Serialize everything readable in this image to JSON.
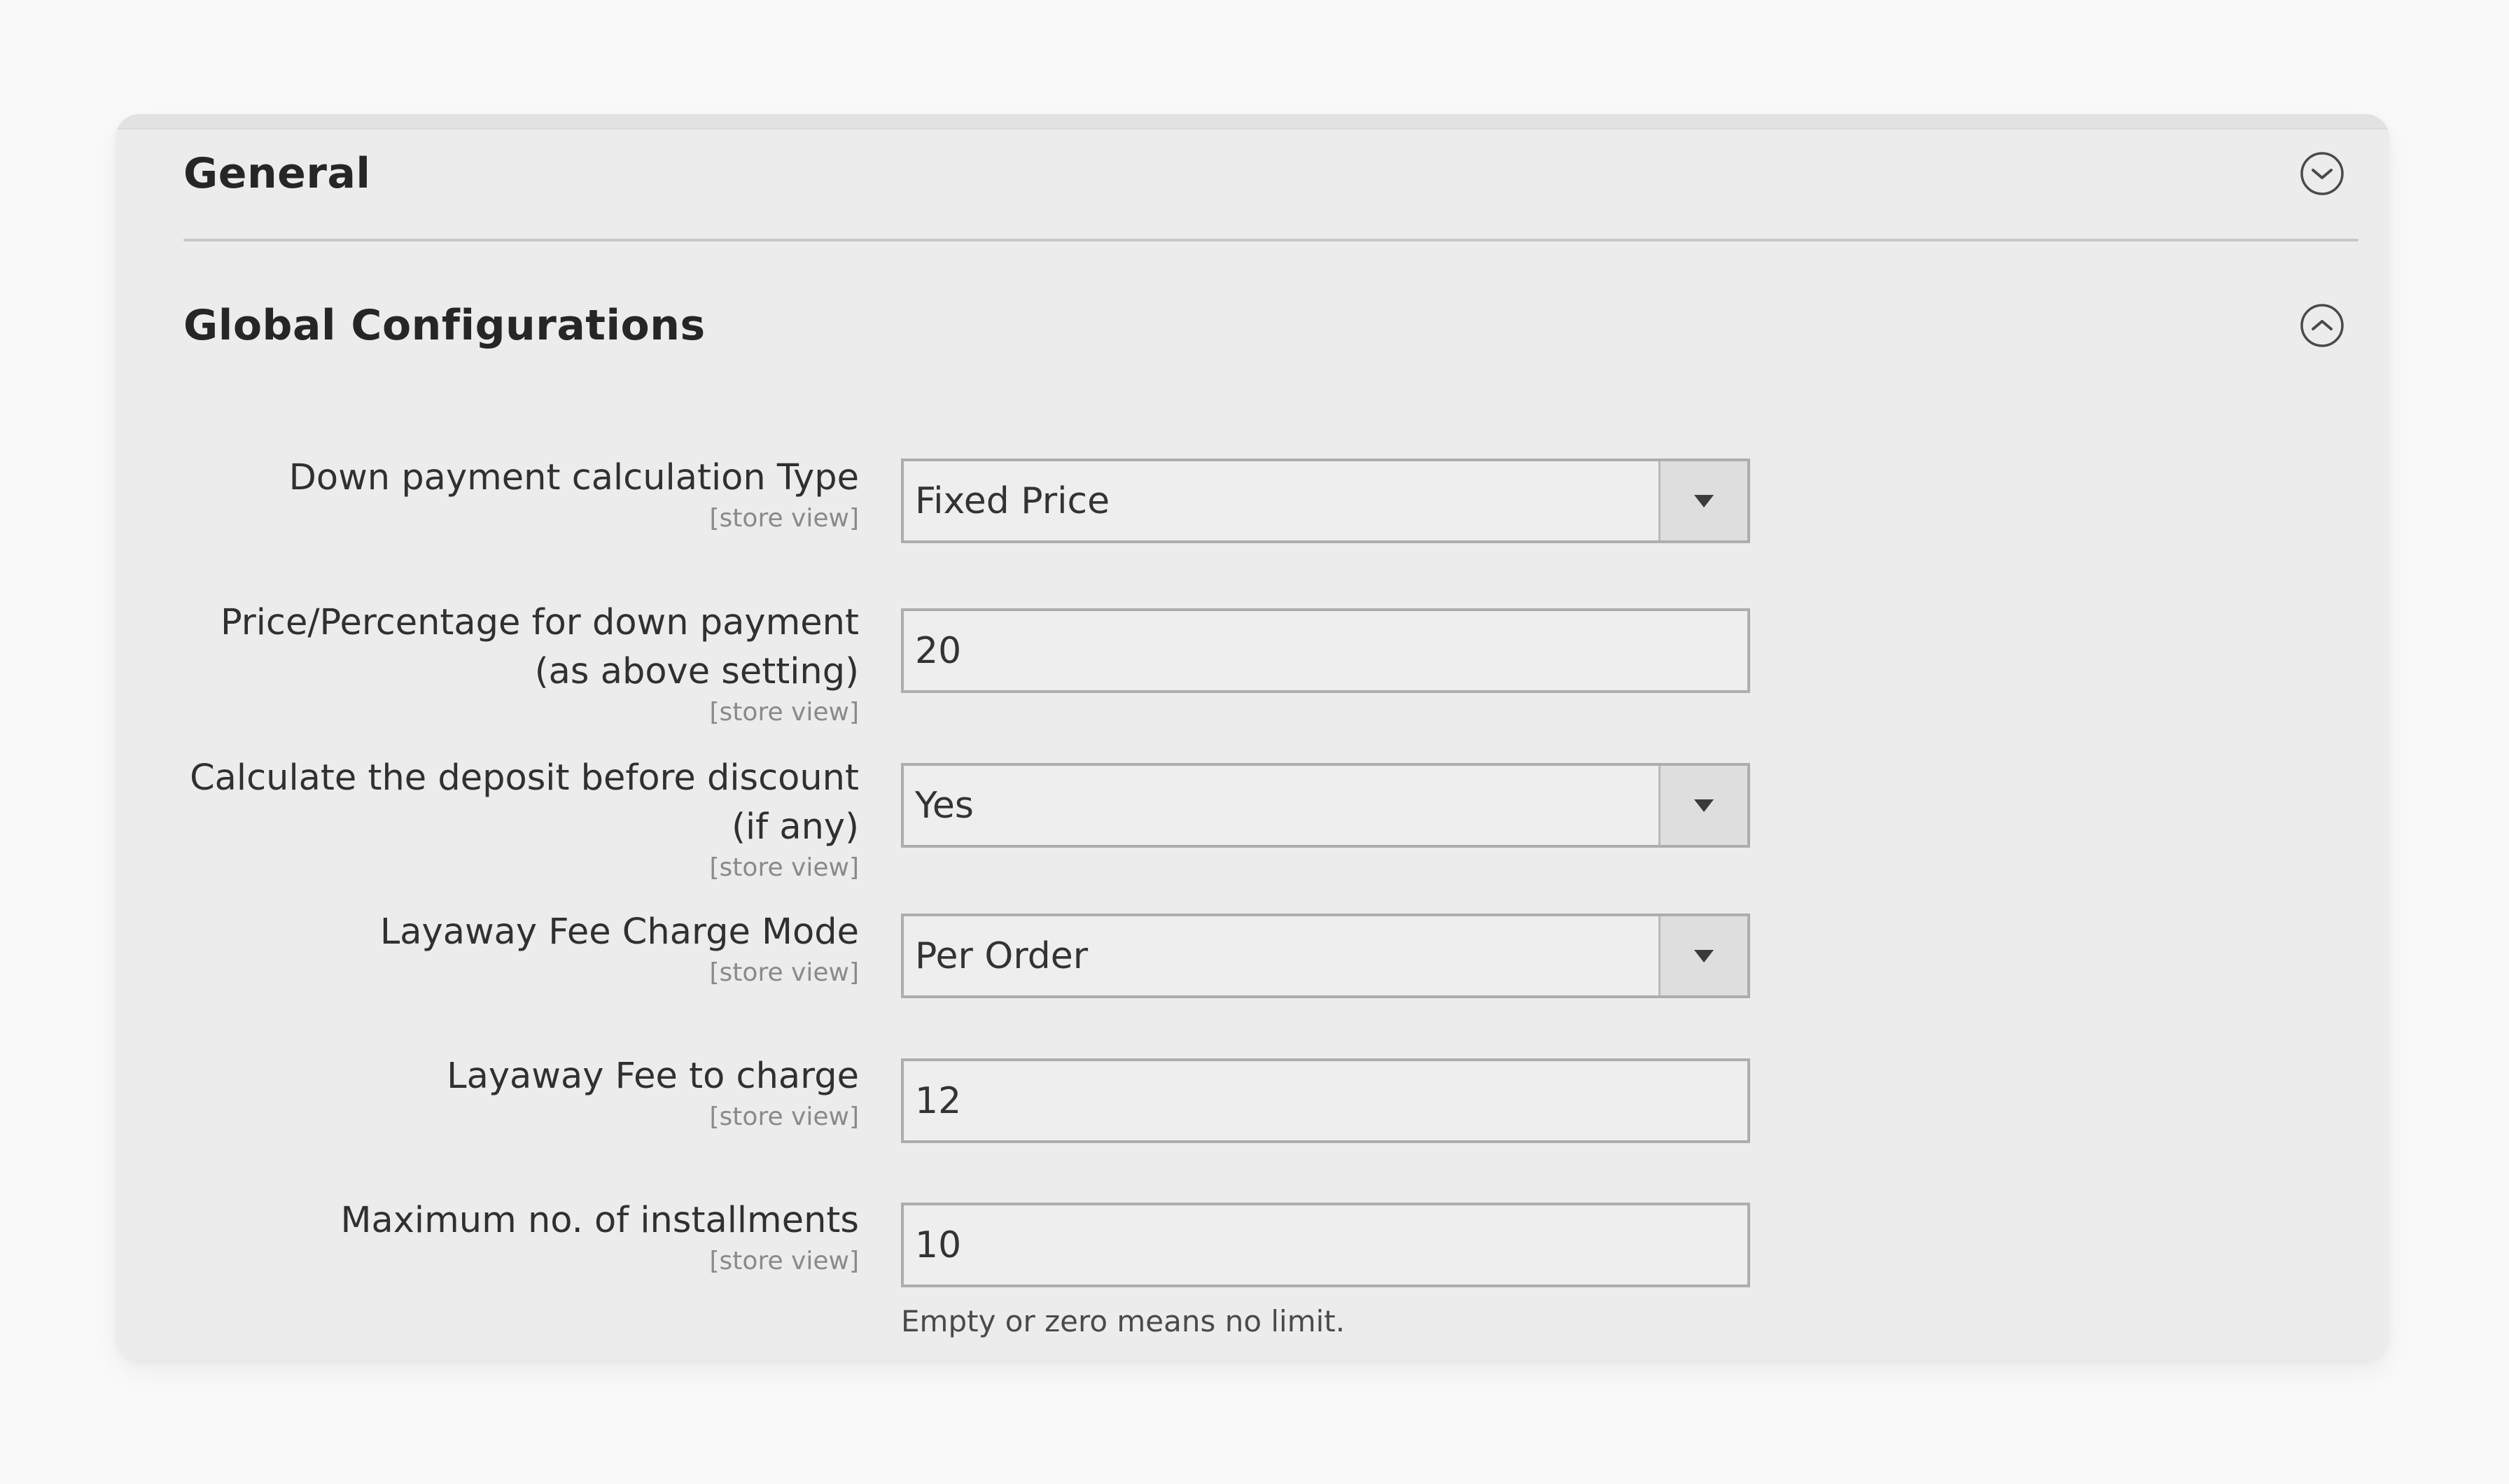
{
  "sections": {
    "general": {
      "title": "General",
      "toggle_icon": "chevron-down-circle-icon",
      "state": "collapsed"
    },
    "global": {
      "title": "Global Configurations",
      "toggle_icon": "chevron-up-circle-icon",
      "state": "expanded"
    }
  },
  "fields": [
    {
      "label_lines": [
        "Down payment calculation Type"
      ],
      "scope": "[store view]",
      "type": "select",
      "value": "Fixed Price"
    },
    {
      "label_lines": [
        "Price/Percentage for down payment",
        "(as above setting)"
      ],
      "scope": "[store view]",
      "type": "text",
      "value": "20"
    },
    {
      "label_lines": [
        "Calculate the deposit before discount",
        "(if any)"
      ],
      "scope": "[store view]",
      "type": "select",
      "value": "Yes"
    },
    {
      "label_lines": [
        "Layaway Fee Charge Mode"
      ],
      "scope": "[store view]",
      "type": "select",
      "value": "Per Order"
    },
    {
      "label_lines": [
        "Layaway Fee to charge"
      ],
      "scope": "[store view]",
      "type": "text",
      "value": "12"
    },
    {
      "label_lines": [
        "Maximum no. of installments"
      ],
      "scope": "[store view]",
      "type": "text",
      "value": "10",
      "note": "Empty or zero means no limit."
    }
  ],
  "colors": {
    "page_bg": "#f9f9f9",
    "panel_bg": "#ececec",
    "text": "#303030",
    "scope_text": "#8a8a8a",
    "input_border": "#adadad"
  }
}
